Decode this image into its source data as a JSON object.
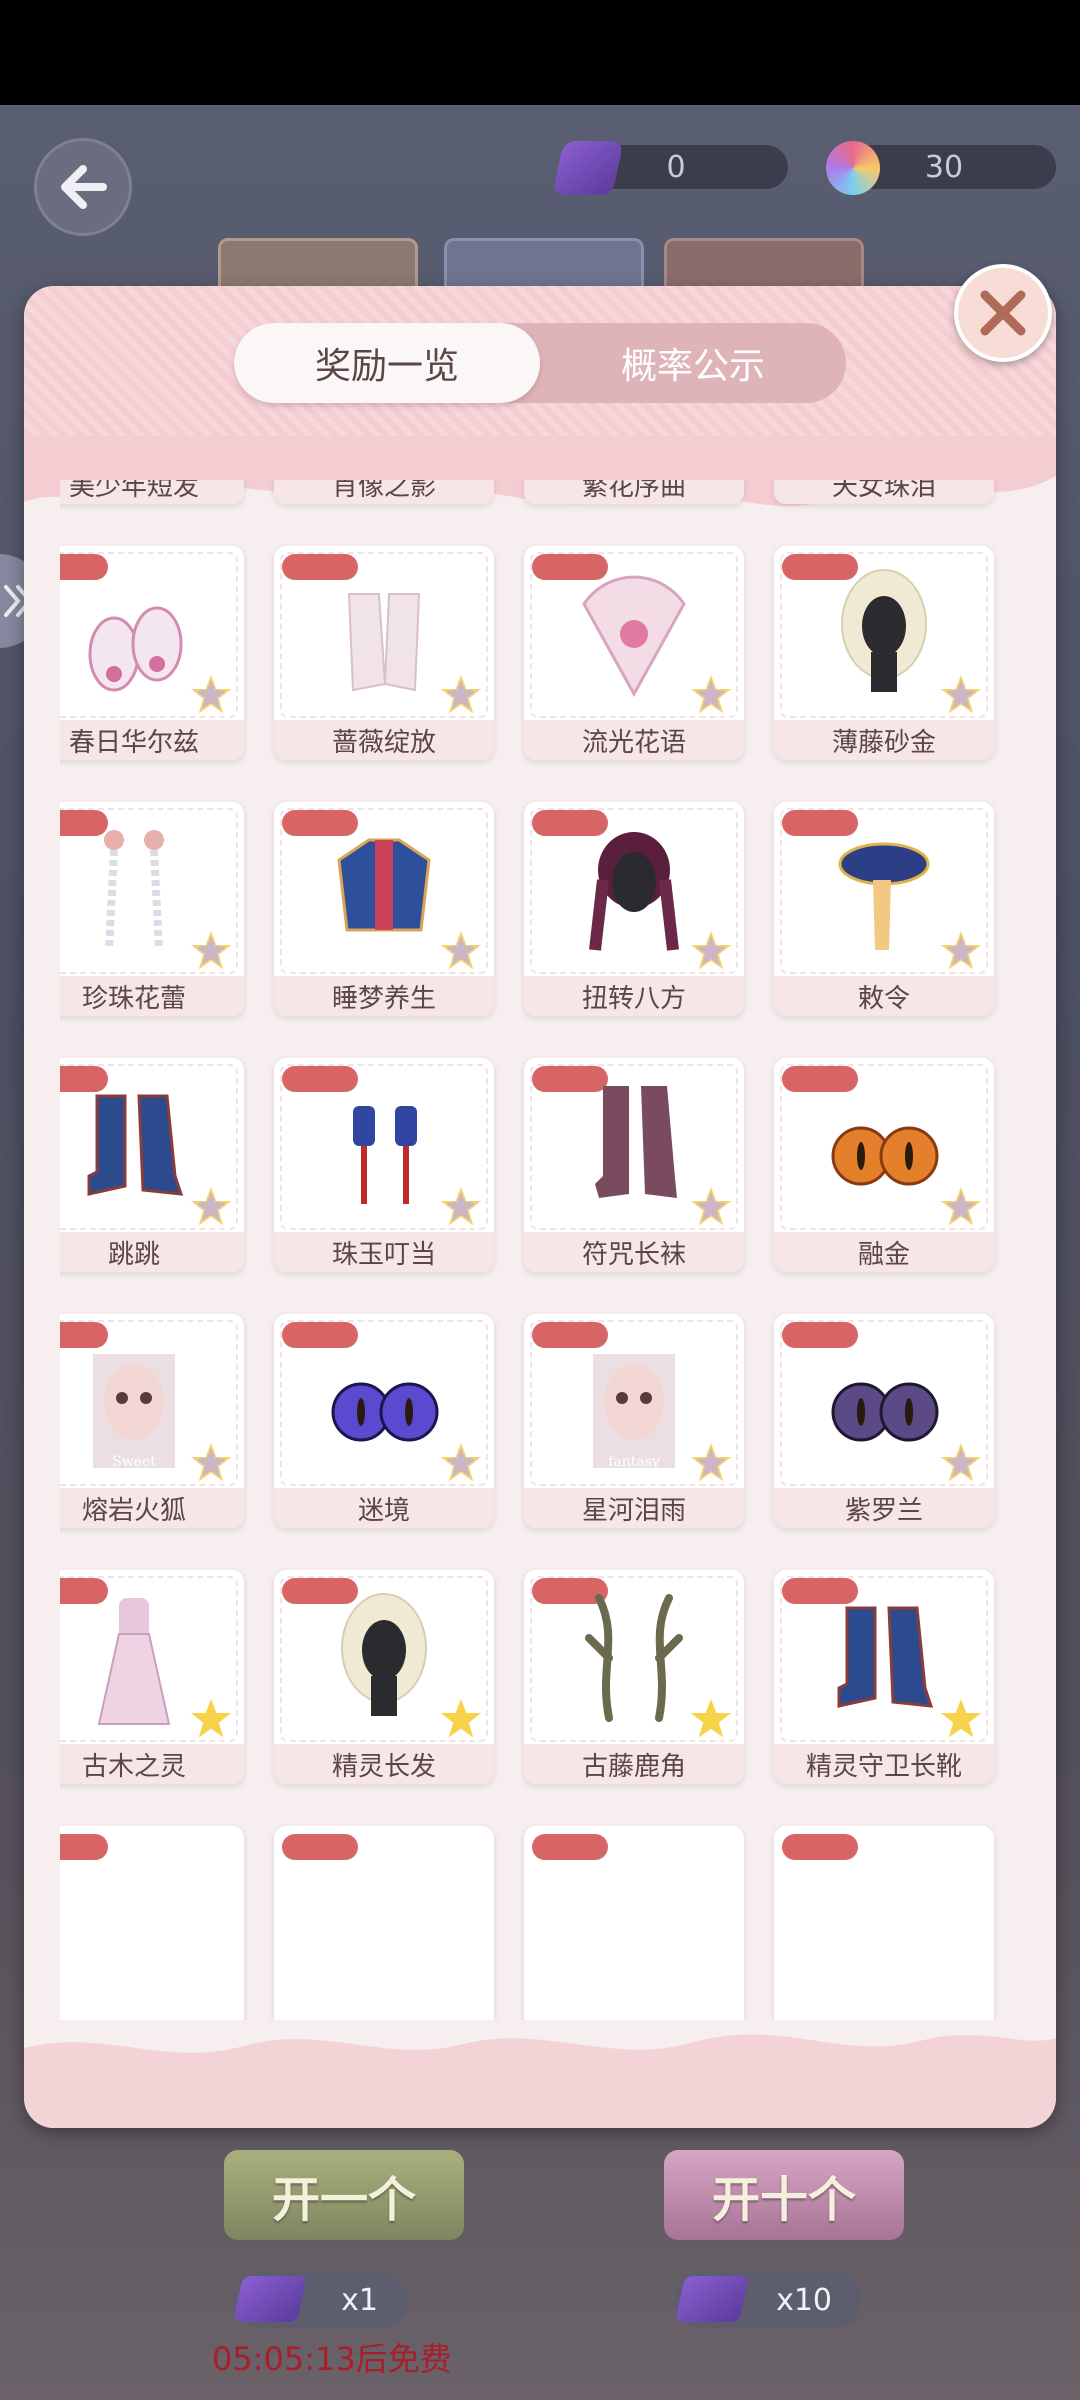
{
  "header": {
    "ticket_count": "0",
    "gem_count": "30"
  },
  "dialog": {
    "tabs": [
      {
        "label": "奖励一览",
        "active": true
      },
      {
        "label": "概率公示",
        "active": false
      }
    ],
    "items": [
      {
        "name": "美少年短发",
        "icon": "short-hair-icon"
      },
      {
        "name": "肖像之影",
        "icon": "outfit-icon"
      },
      {
        "name": "繁花序曲",
        "icon": "dress-icon"
      },
      {
        "name": "天女珠泪",
        "icon": "pearl-headband-icon"
      },
      {
        "name": "春日华尔兹",
        "icon": "shoes-icon"
      },
      {
        "name": "蔷薇绽放",
        "icon": "gloves-icon"
      },
      {
        "name": "流光花语",
        "icon": "fan-icon"
      },
      {
        "name": "薄藤砂金",
        "icon": "long-hair-icon"
      },
      {
        "name": "珍珠花蕾",
        "icon": "earrings-icon"
      },
      {
        "name": "睡梦养生",
        "icon": "jacket-icon"
      },
      {
        "name": "扭转八方",
        "icon": "braid-hair-icon"
      },
      {
        "name": "敕令",
        "icon": "hat-icon"
      },
      {
        "name": "跳跳",
        "icon": "boots-icon"
      },
      {
        "name": "珠玉叮当",
        "icon": "lantern-earrings-icon"
      },
      {
        "name": "符咒长袜",
        "icon": "stockings-icon"
      },
      {
        "name": "融金",
        "icon": "eyes-icon"
      },
      {
        "name": "熔岩火狐",
        "icon": "face-card-icon",
        "caption": "Sweet"
      },
      {
        "name": "迷境",
        "icon": "eyes-icon"
      },
      {
        "name": "星河泪雨",
        "icon": "face-card-icon",
        "caption": "fantasy"
      },
      {
        "name": "紫罗兰",
        "icon": "eyes-icon"
      },
      {
        "name": "古木之灵",
        "icon": "dress-icon"
      },
      {
        "name": "精灵长发",
        "icon": "long-hair-icon"
      },
      {
        "name": "古藤鹿角",
        "icon": "antlers-icon"
      },
      {
        "name": "精灵守卫长靴",
        "icon": "boots-icon"
      }
    ]
  },
  "bottom": {
    "open_one_label": "开一个",
    "open_ten_label": "开十个",
    "cost_one": "x1",
    "cost_ten": "x10",
    "free_timer": "05:05:13后免费"
  },
  "colors": {
    "tag_red": "#d86565",
    "dialog_bg": "#f6eeef",
    "tab_pink": "#dfb4b9",
    "timer_red": "#a81e2a"
  }
}
